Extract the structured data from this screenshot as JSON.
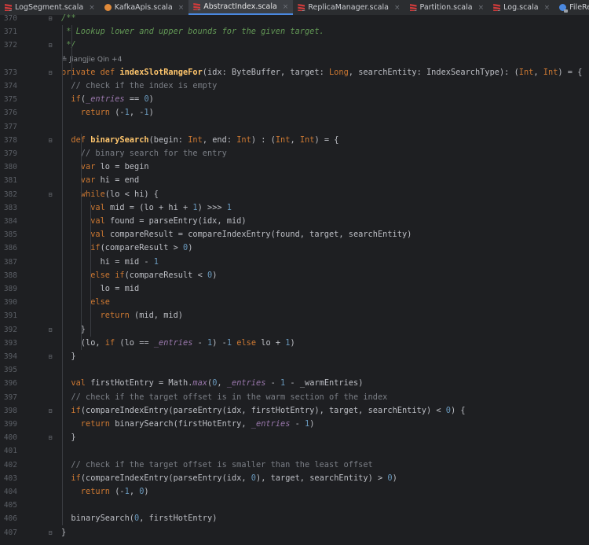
{
  "tabs": [
    {
      "label": "LogSegment.scala",
      "icon": "scala-class-icon",
      "active": false
    },
    {
      "label": "KafkaApis.scala",
      "icon": "scala-object-icon",
      "active": false
    },
    {
      "label": "AbstractIndex.scala",
      "icon": "scala-class-icon",
      "active": true
    },
    {
      "label": "ReplicaManager.scala",
      "icon": "scala-class-icon",
      "active": false
    },
    {
      "label": "Partition.scala",
      "icon": "scala-class-icon",
      "active": false
    },
    {
      "label": "Log.scala",
      "icon": "scala-class-icon",
      "active": false
    },
    {
      "label": "FileRecords.java",
      "icon": "java-class-icon",
      "active": false
    }
  ],
  "close_glyph": "×",
  "author_hint": "Jiangjie Qin +4",
  "lines": [
    {
      "n": "370",
      "tokens": [
        [
          "dc",
          "/**"
        ]
      ]
    },
    {
      "n": "371",
      "tokens": [
        [
          "dc",
          " * Lookup lower and upper bounds for the given target."
        ]
      ]
    },
    {
      "n": "372",
      "tokens": [
        [
          "dc",
          " */"
        ]
      ]
    },
    {
      "n": "",
      "author": true
    },
    {
      "n": "373",
      "tokens": [
        [
          "kw",
          "private def "
        ],
        [
          "fn",
          "indexSlotRangeFor"
        ],
        [
          "pl",
          "(idx: ByteBuffer, target: "
        ],
        [
          "kw",
          "Long"
        ],
        [
          "pl",
          ", searchEntity: IndexSearchType): ("
        ],
        [
          "kw",
          "Int"
        ],
        [
          "pl",
          ", "
        ],
        [
          "kw",
          "Int"
        ],
        [
          "pl",
          ") = {"
        ]
      ]
    },
    {
      "n": "374",
      "tokens": [
        [
          "cm",
          "  // check if the index is empty"
        ]
      ]
    },
    {
      "n": "375",
      "tokens": [
        [
          "kw",
          "  if"
        ],
        [
          "pl",
          "("
        ],
        [
          "it",
          "_entries"
        ],
        [
          "pl",
          " == "
        ],
        [
          "num",
          "0"
        ],
        [
          "pl",
          ")"
        ]
      ]
    },
    {
      "n": "376",
      "tokens": [
        [
          "kw",
          "    return "
        ],
        [
          "pl",
          "(-"
        ],
        [
          "num",
          "1"
        ],
        [
          "pl",
          ", -"
        ],
        [
          "num",
          "1"
        ],
        [
          "pl",
          ")"
        ]
      ]
    },
    {
      "n": "377",
      "tokens": []
    },
    {
      "n": "378",
      "tokens": [
        [
          "kw",
          "  def "
        ],
        [
          "fn",
          "binarySearch"
        ],
        [
          "pl",
          "(begin: "
        ],
        [
          "kw",
          "Int"
        ],
        [
          "pl",
          ", end: "
        ],
        [
          "kw",
          "Int"
        ],
        [
          "pl",
          ") : ("
        ],
        [
          "kw",
          "Int"
        ],
        [
          "pl",
          ", "
        ],
        [
          "kw",
          "Int"
        ],
        [
          "pl",
          ") = {"
        ]
      ]
    },
    {
      "n": "379",
      "tokens": [
        [
          "cm",
          "    // binary search for the entry"
        ]
      ]
    },
    {
      "n": "380",
      "tokens": [
        [
          "kw",
          "    var "
        ],
        [
          "pl",
          "lo = begin"
        ]
      ]
    },
    {
      "n": "381",
      "tokens": [
        [
          "kw",
          "    var "
        ],
        [
          "pl",
          "hi = end"
        ]
      ]
    },
    {
      "n": "382",
      "tokens": [
        [
          "kw",
          "    while"
        ],
        [
          "pl",
          "(lo < hi) {"
        ]
      ]
    },
    {
      "n": "383",
      "tokens": [
        [
          "kw",
          "      val "
        ],
        [
          "pl",
          "mid = (lo + hi + "
        ],
        [
          "num",
          "1"
        ],
        [
          "pl",
          ") >>> "
        ],
        [
          "num",
          "1"
        ]
      ]
    },
    {
      "n": "384",
      "tokens": [
        [
          "kw",
          "      val "
        ],
        [
          "pl",
          "found = parseEntry(idx, mid)"
        ]
      ]
    },
    {
      "n": "385",
      "tokens": [
        [
          "kw",
          "      val "
        ],
        [
          "pl",
          "compareResult = compareIndexEntry(found, target, searchEntity)"
        ]
      ]
    },
    {
      "n": "386",
      "tokens": [
        [
          "kw",
          "      if"
        ],
        [
          "pl",
          "(compareResult > "
        ],
        [
          "num",
          "0"
        ],
        [
          "pl",
          ")"
        ]
      ]
    },
    {
      "n": "387",
      "tokens": [
        [
          "pl",
          "        hi = mid - "
        ],
        [
          "num",
          "1"
        ]
      ]
    },
    {
      "n": "388",
      "tokens": [
        [
          "kw",
          "      else if"
        ],
        [
          "pl",
          "(compareResult < "
        ],
        [
          "num",
          "0"
        ],
        [
          "pl",
          ")"
        ]
      ]
    },
    {
      "n": "389",
      "tokens": [
        [
          "pl",
          "        lo = mid"
        ]
      ]
    },
    {
      "n": "390",
      "tokens": [
        [
          "kw",
          "      else"
        ]
      ]
    },
    {
      "n": "391",
      "tokens": [
        [
          "kw",
          "        return "
        ],
        [
          "pl",
          "(mid, mid)"
        ]
      ]
    },
    {
      "n": "392",
      "tokens": [
        [
          "pl",
          "    }"
        ]
      ]
    },
    {
      "n": "393",
      "tokens": [
        [
          "pl",
          "    (lo, "
        ],
        [
          "kw",
          "if "
        ],
        [
          "pl",
          "(lo == "
        ],
        [
          "it",
          "_entries"
        ],
        [
          "pl",
          " - "
        ],
        [
          "num",
          "1"
        ],
        [
          "pl",
          ") -"
        ],
        [
          "num",
          "1 "
        ],
        [
          "kw",
          "else "
        ],
        [
          "pl",
          "lo + "
        ],
        [
          "num",
          "1"
        ],
        [
          "pl",
          ")"
        ]
      ]
    },
    {
      "n": "394",
      "tokens": [
        [
          "pl",
          "  }"
        ]
      ]
    },
    {
      "n": "395",
      "tokens": []
    },
    {
      "n": "396",
      "tokens": [
        [
          "kw",
          "  val "
        ],
        [
          "pl",
          "firstHotEntry = Math."
        ],
        [
          "it",
          "max"
        ],
        [
          "pl",
          "("
        ],
        [
          "num",
          "0"
        ],
        [
          "pl",
          ", "
        ],
        [
          "it",
          "_entries"
        ],
        [
          "pl",
          " - "
        ],
        [
          "num",
          "1"
        ],
        [
          "pl",
          " - _warmEntries)"
        ]
      ]
    },
    {
      "n": "397",
      "tokens": [
        [
          "cm",
          "  // check if the target offset is in the warm section of the index"
        ]
      ]
    },
    {
      "n": "398",
      "tokens": [
        [
          "kw",
          "  if"
        ],
        [
          "pl",
          "(compareIndexEntry(parseEntry(idx, firstHotEntry), target, searchEntity) < "
        ],
        [
          "num",
          "0"
        ],
        [
          "pl",
          ") {"
        ]
      ]
    },
    {
      "n": "399",
      "tokens": [
        [
          "kw",
          "    return "
        ],
        [
          "pl",
          "binarySearch(firstHotEntry, "
        ],
        [
          "it",
          "_entries"
        ],
        [
          "pl",
          " - "
        ],
        [
          "num",
          "1"
        ],
        [
          "pl",
          ")"
        ]
      ]
    },
    {
      "n": "400",
      "tokens": [
        [
          "pl",
          "  }"
        ]
      ]
    },
    {
      "n": "401",
      "tokens": []
    },
    {
      "n": "402",
      "tokens": [
        [
          "cm",
          "  // check if the target offset is smaller than the least offset"
        ]
      ]
    },
    {
      "n": "403",
      "tokens": [
        [
          "kw",
          "  if"
        ],
        [
          "pl",
          "(compareIndexEntry(parseEntry(idx, "
        ],
        [
          "num",
          "0"
        ],
        [
          "pl",
          "), target, searchEntity) > "
        ],
        [
          "num",
          "0"
        ],
        [
          "pl",
          ")"
        ]
      ]
    },
    {
      "n": "404",
      "tokens": [
        [
          "kw",
          "    return "
        ],
        [
          "pl",
          "(-"
        ],
        [
          "num",
          "1"
        ],
        [
          "pl",
          ", "
        ],
        [
          "num",
          "0"
        ],
        [
          "pl",
          ")"
        ]
      ]
    },
    {
      "n": "405",
      "tokens": []
    },
    {
      "n": "406",
      "tokens": [
        [
          "pl",
          "  binarySearch("
        ],
        [
          "num",
          "0"
        ],
        [
          "pl",
          ", firstHotEntry)"
        ]
      ]
    },
    {
      "n": "407",
      "tokens": [
        [
          "pl",
          "}"
        ]
      ]
    }
  ],
  "colors": {
    "keyword": "#cc7832",
    "function": "#ffc66d",
    "number": "#6897bb",
    "comment": "#7a7e85",
    "doc": "#629755",
    "field": "#9876aa",
    "plain": "#bcbec4",
    "background": "#1e1f22",
    "tab_active_border": "#4a88e0"
  }
}
